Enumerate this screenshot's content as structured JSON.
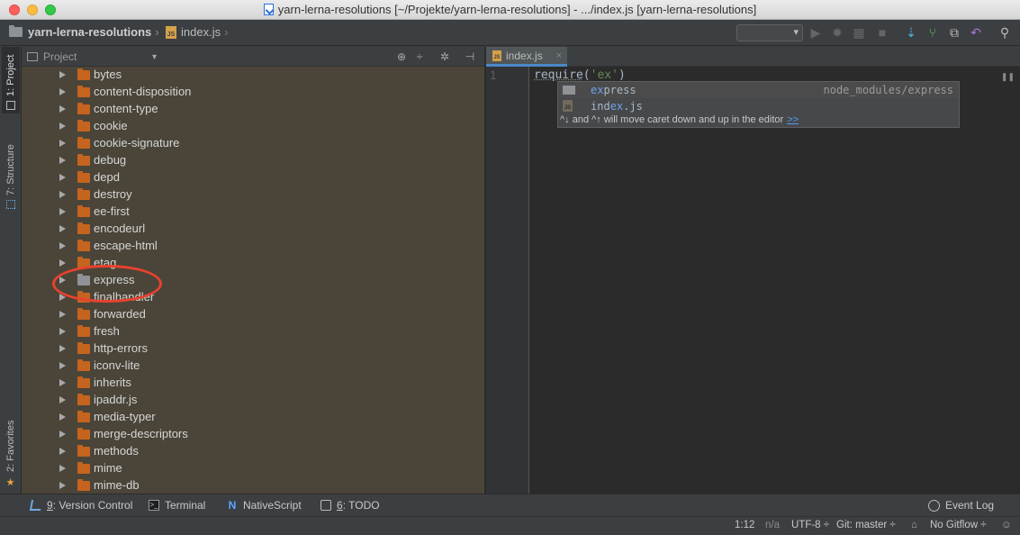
{
  "window": {
    "title": "yarn-lerna-resolutions [~/Projekte/yarn-lerna-resolutions] - .../index.js [yarn-lerna-resolutions]"
  },
  "navbar": {
    "root": "yarn-lerna-resolutions",
    "file": "index.js"
  },
  "left_stripe": {
    "project_tab": "1: Project",
    "structure_tab": "7: Structure",
    "favorites_tab": "2: Favorites"
  },
  "project_panel": {
    "view_selector": "Project",
    "items": [
      {
        "label": "bytes",
        "icon": "folder-icon"
      },
      {
        "label": "content-disposition",
        "icon": "folder-icon"
      },
      {
        "label": "content-type",
        "icon": "folder-icon"
      },
      {
        "label": "cookie",
        "icon": "folder-icon"
      },
      {
        "label": "cookie-signature",
        "icon": "folder-icon"
      },
      {
        "label": "debug",
        "icon": "folder-icon"
      },
      {
        "label": "depd",
        "icon": "folder-icon"
      },
      {
        "label": "destroy",
        "icon": "folder-icon"
      },
      {
        "label": "ee-first",
        "icon": "folder-icon"
      },
      {
        "label": "encodeurl",
        "icon": "folder-icon"
      },
      {
        "label": "escape-html",
        "icon": "folder-icon"
      },
      {
        "label": "etag",
        "icon": "folder-icon"
      },
      {
        "label": "express",
        "icon": "folder-icon-gray"
      },
      {
        "label": "finalhandler",
        "icon": "folder-icon"
      },
      {
        "label": "forwarded",
        "icon": "folder-icon"
      },
      {
        "label": "fresh",
        "icon": "folder-icon"
      },
      {
        "label": "http-errors",
        "icon": "folder-icon"
      },
      {
        "label": "iconv-lite",
        "icon": "folder-icon"
      },
      {
        "label": "inherits",
        "icon": "folder-icon"
      },
      {
        "label": "ipaddr.js",
        "icon": "folder-icon"
      },
      {
        "label": "media-typer",
        "icon": "folder-icon"
      },
      {
        "label": "merge-descriptors",
        "icon": "folder-icon"
      },
      {
        "label": "methods",
        "icon": "folder-icon"
      },
      {
        "label": "mime",
        "icon": "folder-icon"
      },
      {
        "label": "mime-db",
        "icon": "folder-icon"
      }
    ]
  },
  "editor": {
    "tab_label": "index.js",
    "line_number": "1",
    "code_fn": "require",
    "code_open": "(",
    "code_string": "'ex'",
    "code_close": ")"
  },
  "completion": {
    "items": [
      {
        "prefix": "ex",
        "rest": "press",
        "type": "node_modules/express"
      },
      {
        "before": "ind",
        "match": "ex",
        "after": ".js",
        "type": ""
      }
    ],
    "hint": "^↓ and ^↑ will move caret down and up in the editor",
    "hint_link": ">>"
  },
  "bottom_bar": {
    "version_control_key": "9",
    "version_control": ": Version Control",
    "terminal": "Terminal",
    "nativescript": "NativeScript",
    "todo_key": "6",
    "todo": ": TODO",
    "event_log": "Event Log"
  },
  "status_bar": {
    "position": "1:12",
    "na": "n/a",
    "encoding": "UTF-8 ÷",
    "git": "Git: master ÷",
    "gitflow": "No Gitflow ÷"
  }
}
